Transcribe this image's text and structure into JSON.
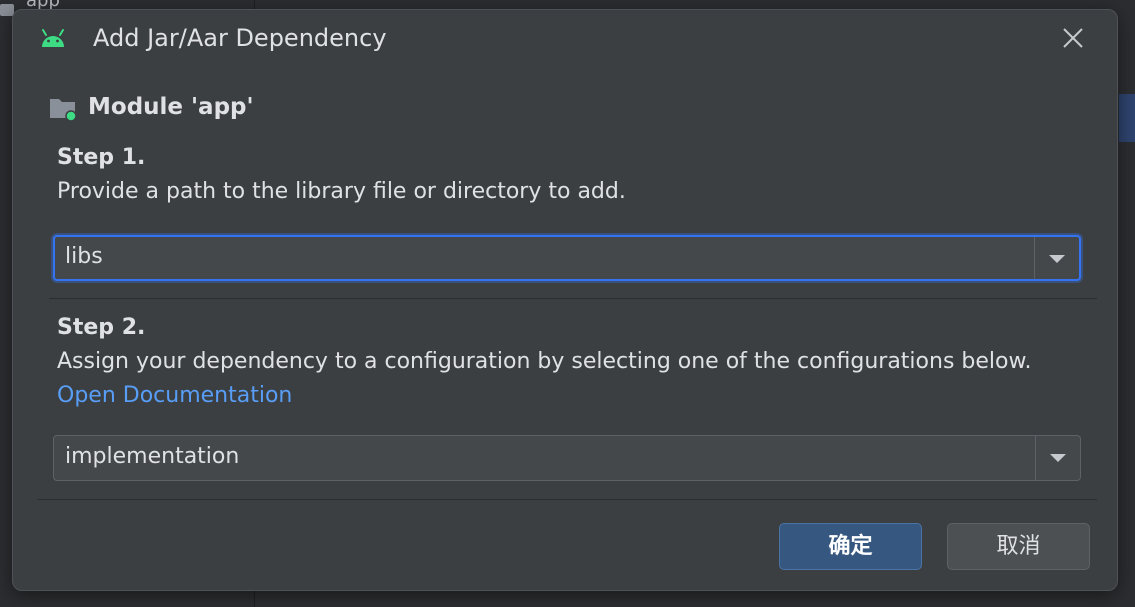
{
  "background": {
    "partial_text": "app"
  },
  "dialog": {
    "title": "Add Jar/Aar Dependency",
    "module_label": "Module 'app'",
    "step1": {
      "title": "Step 1.",
      "description": "Provide a path to the library file or directory to add.",
      "path_value": "libs"
    },
    "step2": {
      "title": "Step 2.",
      "description": "Assign your dependency to a configuration by selecting one of the configurations below.",
      "link": "Open Documentation",
      "configuration_value": "implementation"
    },
    "buttons": {
      "ok": "确定",
      "cancel": "取消"
    }
  },
  "colors": {
    "dialog_bg": "#3c3f41",
    "text": "#dfe1e5",
    "link": "#589df6",
    "focus": "#3574f0",
    "primary_button": "#365880",
    "android_green": "#3ddc84"
  },
  "icons": {
    "title": "android-icon",
    "module": "module-folder-icon",
    "close": "close-icon",
    "dropdown": "chevron-down-icon"
  }
}
